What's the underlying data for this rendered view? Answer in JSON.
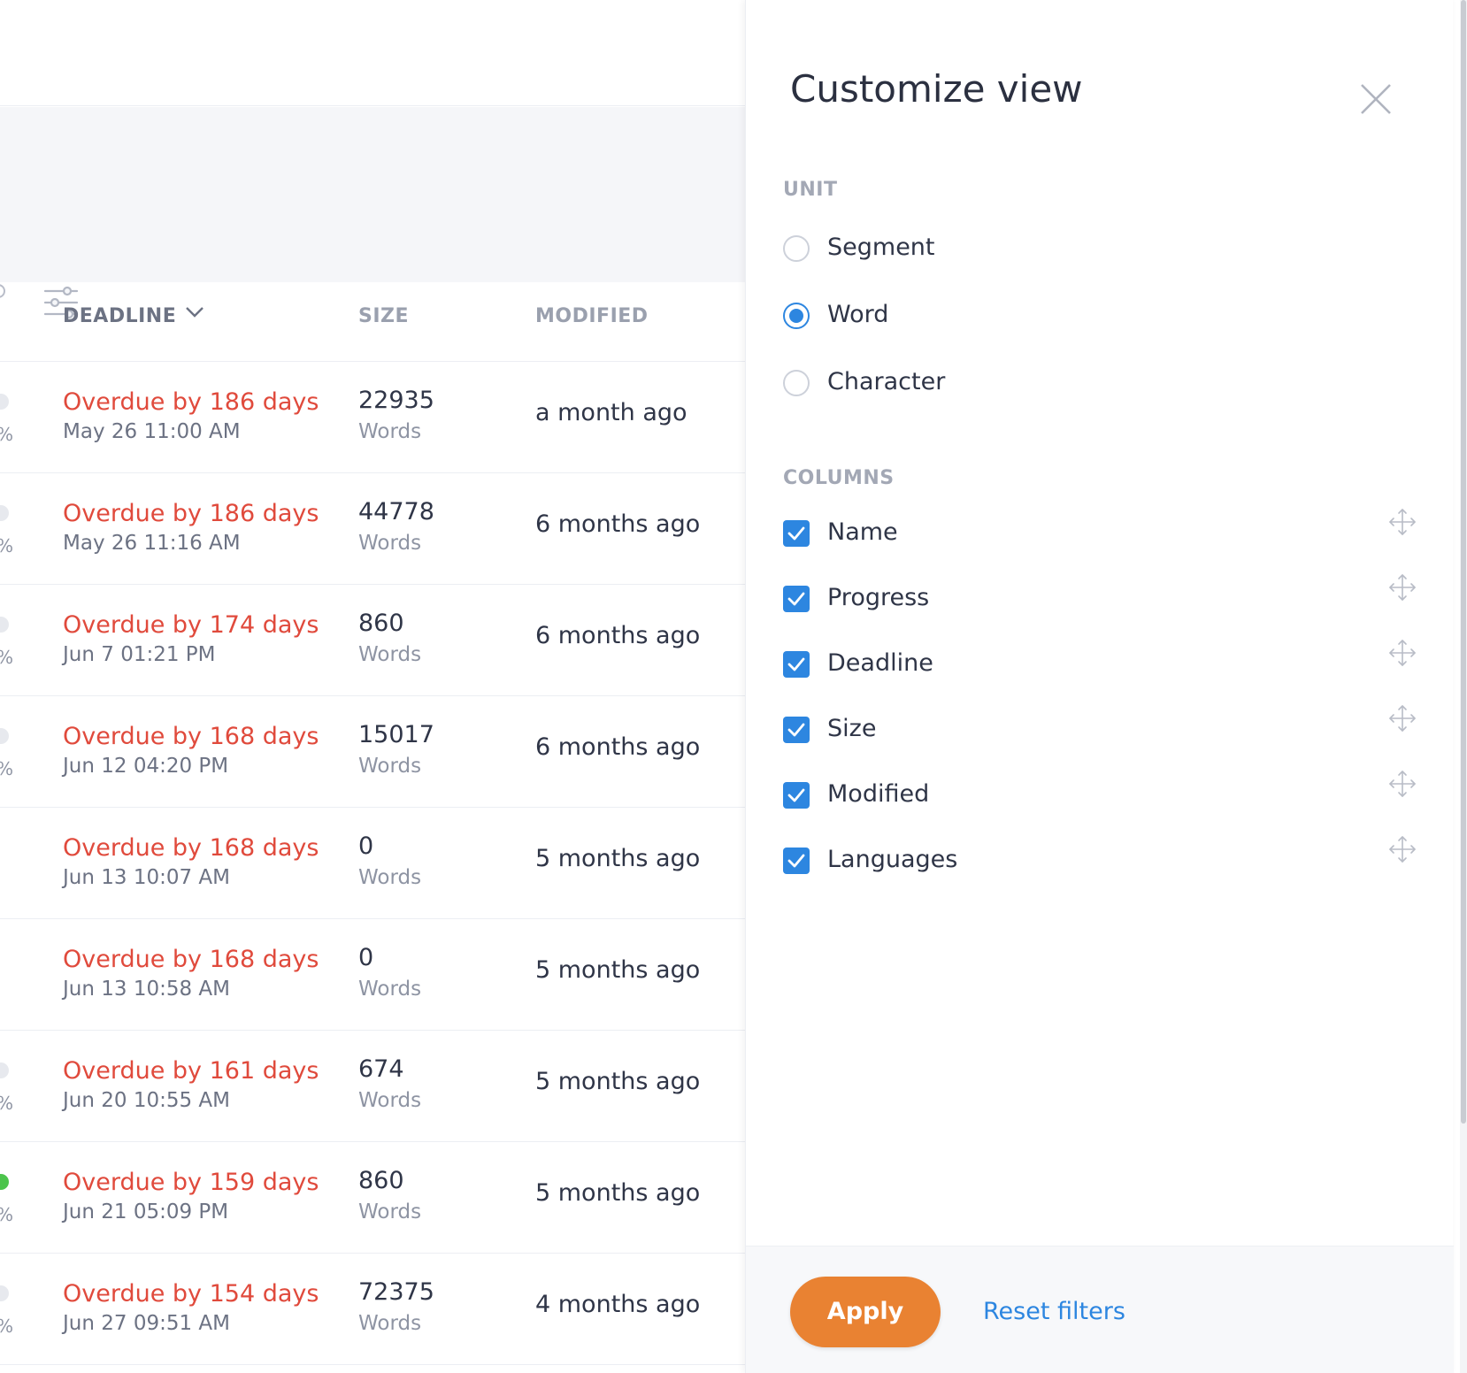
{
  "table": {
    "headers": {
      "deadline": "DEADLINE",
      "size": "SIZE",
      "modified": "MODIFIED"
    },
    "rows": [
      {
        "overdue": "Overdue by 186 days",
        "due": "May 26 11:00 AM",
        "size": "22935",
        "unit": "Words",
        "modified": "a month ago",
        "pct": "%"
      },
      {
        "overdue": "Overdue by 186 days",
        "due": "May 26 11:16 AM",
        "size": "44778",
        "unit": "Words",
        "modified": "6 months ago",
        "pct": "%"
      },
      {
        "overdue": "Overdue by 174 days",
        "due": "Jun 7 01:21 PM",
        "size": "860",
        "unit": "Words",
        "modified": "6 months ago",
        "pct": "%"
      },
      {
        "overdue": "Overdue by 168 days",
        "due": "Jun 12 04:20 PM",
        "size": "15017",
        "unit": "Words",
        "modified": "6 months ago",
        "pct": "%"
      },
      {
        "overdue": "Overdue by 168 days",
        "due": "Jun 13 10:07 AM",
        "size": "0",
        "unit": "Words",
        "modified": "5 months ago",
        "pct": ""
      },
      {
        "overdue": "Overdue by 168 days",
        "due": "Jun 13 10:58 AM",
        "size": "0",
        "unit": "Words",
        "modified": "5 months ago",
        "pct": ""
      },
      {
        "overdue": "Overdue by 161 days",
        "due": "Jun 20 10:55 AM",
        "size": "674",
        "unit": "Words",
        "modified": "5 months ago",
        "pct": "%"
      },
      {
        "overdue": "Overdue by 159 days",
        "due": "Jun 21 05:09 PM",
        "size": "860",
        "unit": "Words",
        "modified": "5 months ago",
        "pct": "%"
      },
      {
        "overdue": "Overdue by 154 days",
        "due": "Jun 27 09:51 AM",
        "size": "72375",
        "unit": "Words",
        "modified": "4 months ago",
        "pct": "%"
      }
    ]
  },
  "panel": {
    "title": "Customize view",
    "unit_label": "UNIT",
    "units": [
      {
        "label": "Segment",
        "checked": false
      },
      {
        "label": "Word",
        "checked": true
      },
      {
        "label": "Character",
        "checked": false
      }
    ],
    "columns_label": "COLUMNS",
    "columns": [
      {
        "label": "Name",
        "checked": true
      },
      {
        "label": "Progress",
        "checked": true
      },
      {
        "label": "Deadline",
        "checked": true
      },
      {
        "label": "Size",
        "checked": true
      },
      {
        "label": "Modified",
        "checked": true
      },
      {
        "label": "Languages",
        "checked": true
      }
    ],
    "apply": "Apply",
    "reset": "Reset filters"
  },
  "colors": {
    "overdue": "#e04a3c",
    "accent": "#2d86e0",
    "apply": "#e98232",
    "progress_dot_active": "#4cc44c"
  }
}
